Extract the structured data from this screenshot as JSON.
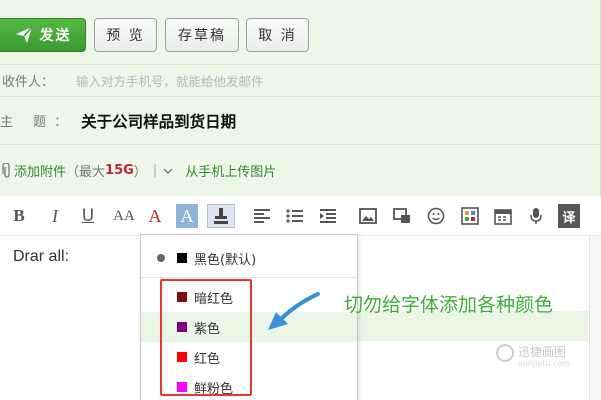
{
  "toolbar": {
    "send_label": "发送",
    "preview_label": "预 览",
    "draft_label": "存草稿",
    "cancel_label": "取 消"
  },
  "recipient": {
    "label": "收件人：",
    "placeholder": "输入对方手机号，就能给他发邮件"
  },
  "subject": {
    "label": "主 题：",
    "value": "关于公司样品到货日期"
  },
  "attachment": {
    "link": "添加附件",
    "paren_open": "（最大",
    "size": "15G",
    "paren_close": "）",
    "separator": "|",
    "phone_upload": "从手机上传图片"
  },
  "format_toolbar": {
    "bold": "B",
    "italic": "I",
    "underline": "U",
    "font_size": "AA",
    "font_color": "A",
    "bg_color": "A",
    "translate": "译",
    "icons": [
      "align-left-icon",
      "bullet-list-icon",
      "indent-icon",
      "image-icon",
      "screenshot-icon",
      "emoji-icon",
      "template-icon",
      "calendar-icon",
      "microphone-icon"
    ]
  },
  "editor": {
    "text": "Drar all:"
  },
  "color_menu": {
    "default_label": "黑色(默认)",
    "items": [
      {
        "label": "暗红色",
        "color": "#7f1010"
      },
      {
        "label": "紫色",
        "color": "#800080"
      },
      {
        "label": "红色",
        "color": "#ff0000"
      },
      {
        "label": "鲜粉色",
        "color": "#ff00ff"
      }
    ],
    "default_color": "#000000"
  },
  "annotation": {
    "text": "切勿给字体添加各种颜色"
  },
  "watermark": {
    "text": "迅捷画图",
    "sub": "xunjietu.com"
  },
  "colors": {
    "accent_green": "#3a9a2f",
    "panel_bg": "#eef6ea",
    "highlight_red": "#e53a2f",
    "arrow_blue": "#3a8fd8"
  }
}
